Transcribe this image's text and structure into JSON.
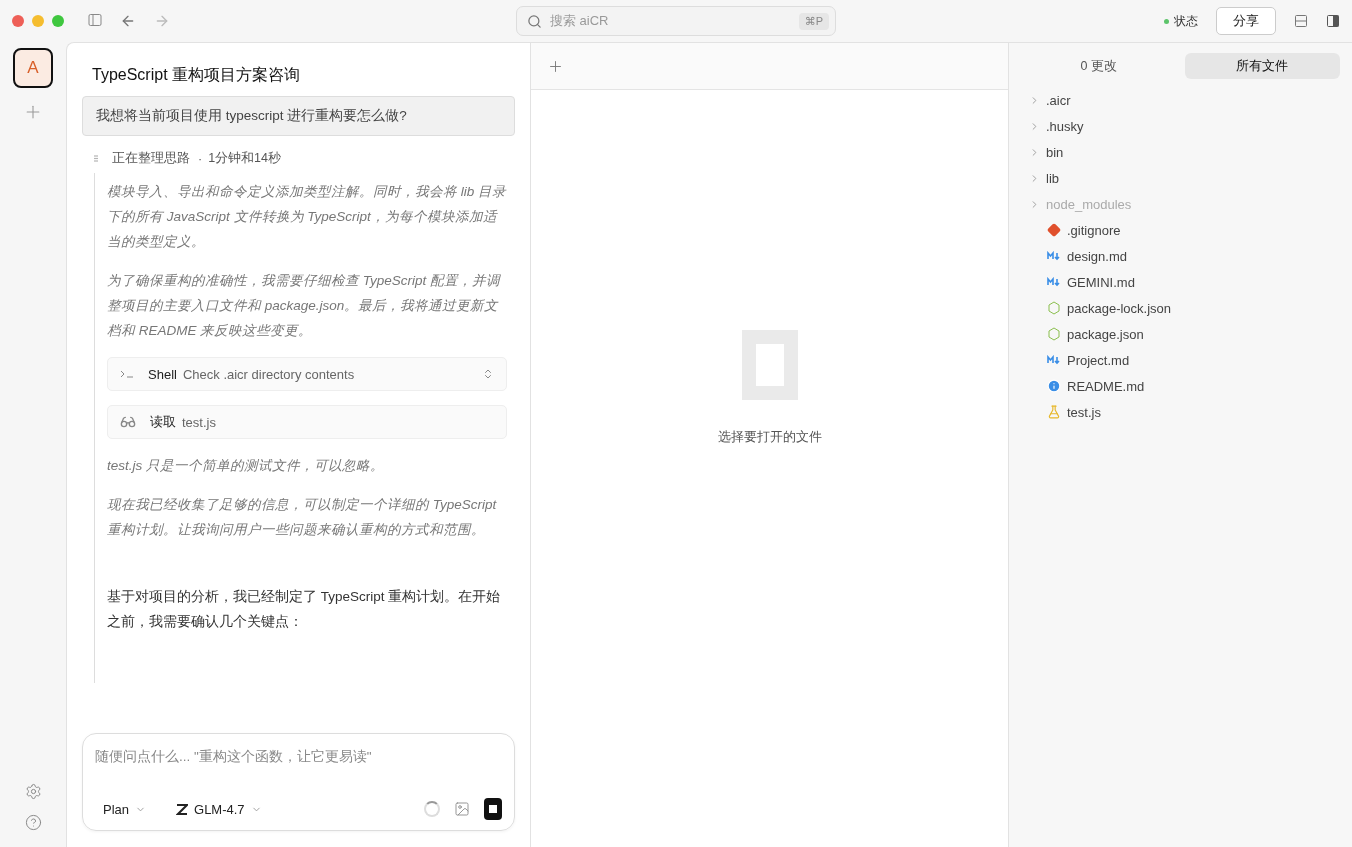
{
  "titlebar": {
    "search": {
      "placeholder": "搜索 aiCR",
      "shortcut": "⌘P"
    },
    "status": {
      "label": "状态",
      "color": "#5cc46a"
    },
    "share": "分享"
  },
  "rail": {
    "avatar": {
      "letter": "A",
      "selected": true
    }
  },
  "chat": {
    "title": "TypeScript 重构项目方案咨询",
    "question": "我想将当前项目使用 typescript 进行重构要怎么做?",
    "thinking": {
      "label": "正在整理思路",
      "separator": "·",
      "duration": "1分钟和14秒"
    },
    "messages": [
      {
        "kind": "thought",
        "text": "模块导入、导出和命令定义添加类型注解。同时，我会将 lib 目录下的所有 JavaScript 文件转换为 TypeScript，为每个模块添加适当的类型定义。"
      },
      {
        "kind": "thought",
        "text": "为了确保重构的准确性，我需要仔细检查 TypeScript 配置，并调整项目的主要入口文件和 package.json。最后，我将通过更新文档和 README 来反映这些变更。"
      },
      {
        "kind": "shell",
        "label": "Shell",
        "detail": "Check .aicr directory contents",
        "expandable": true
      },
      {
        "kind": "read",
        "label": "读取",
        "detail": "test.js",
        "expandable": false
      },
      {
        "kind": "thought",
        "text": "test.js 只是一个简单的测试文件，可以忽略。"
      },
      {
        "kind": "thought",
        "text": "现在我已经收集了足够的信息，可以制定一个详细的 TypeScript 重构计划。让我询问用户一些问题来确认重构的方式和范围。"
      },
      {
        "kind": "answer",
        "text": "基于对项目的分析，我已经制定了 TypeScript 重构计划。在开始之前，我需要确认几个关键点："
      }
    ],
    "composer": {
      "placeholder": "随便问点什么... \"重构这个函数，让它更易读\"",
      "mode": "Plan",
      "model": "GLM-4.7",
      "busy": true
    }
  },
  "editor": {
    "empty_message": "选择要打开的文件"
  },
  "files": {
    "tabs": [
      {
        "label": "0 更改",
        "selected": false
      },
      {
        "label": "所有文件",
        "selected": true
      }
    ],
    "items": [
      {
        "kind": "folder",
        "name": ".aicr",
        "ignored": false,
        "expanded": false
      },
      {
        "kind": "folder",
        "name": ".husky",
        "ignored": false,
        "expanded": false
      },
      {
        "kind": "folder",
        "name": "bin",
        "ignored": false,
        "expanded": false
      },
      {
        "kind": "folder",
        "name": "lib",
        "ignored": false,
        "expanded": false
      },
      {
        "kind": "folder",
        "name": "node_modules",
        "ignored": true,
        "expanded": false
      },
      {
        "kind": "git",
        "name": ".gitignore",
        "ignored": false
      },
      {
        "kind": "markdown",
        "name": "design.md",
        "ignored": false
      },
      {
        "kind": "markdown",
        "name": "GEMINI.md",
        "ignored": false
      },
      {
        "kind": "json",
        "name": "package-lock.json",
        "ignored": false
      },
      {
        "kind": "json",
        "name": "package.json",
        "ignored": false
      },
      {
        "kind": "markdown",
        "name": "Project.md",
        "ignored": false
      },
      {
        "kind": "info",
        "name": "README.md",
        "ignored": false
      },
      {
        "kind": "test",
        "name": "test.js",
        "ignored": false
      }
    ]
  }
}
